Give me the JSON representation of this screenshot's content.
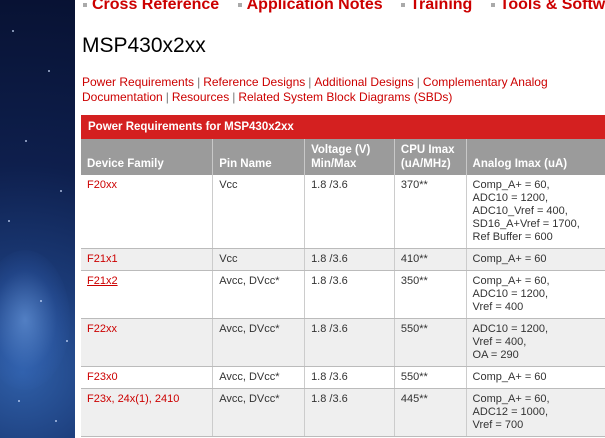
{
  "nav": {
    "items": [
      {
        "label": "Cross Reference"
      },
      {
        "label": "Application Notes"
      },
      {
        "label": "Training"
      },
      {
        "label": "Tools & Software"
      }
    ]
  },
  "page": {
    "title": "MSP430x2xx"
  },
  "quicklinks": [
    "Power Requirements",
    "Reference Designs",
    "Additional Designs",
    "Complementary Analog Documentation",
    "Resources",
    "Related System Block Diagrams (SBDs)"
  ],
  "table": {
    "caption": "Power Requirements for MSP430x2xx",
    "headers": {
      "device": "Device Family",
      "pin": "Pin Name",
      "voltage": "Voltage (V) Min/Max",
      "cpu": "CPU Imax (uA/MHz)",
      "analog": "Analog Imax (uA)"
    },
    "rows": [
      {
        "device": "F20xx",
        "pin": "Vcc",
        "voltage": "1.8 /3.6",
        "cpu": "370**",
        "analog": [
          "Comp_A+ = 60,",
          "ADC10 = 1200,",
          "ADC10_Vref = 400,",
          "SD16_A+Vref = 1700,",
          "Ref Buffer = 600"
        ]
      },
      {
        "device": "F21x1",
        "pin": "Vcc",
        "voltage": "1.8 /3.6",
        "cpu": "410**",
        "analog": [
          "Comp_A+ = 60"
        ]
      },
      {
        "device": "F21x2",
        "pin": "Avcc, DVcc*",
        "voltage": "1.8 /3.6",
        "cpu": "350**",
        "analog": [
          "Comp_A+ = 60,",
          "ADC10 = 1200,",
          "Vref = 400"
        ]
      },
      {
        "device": "F22xx",
        "pin": "Avcc, DVcc*",
        "voltage": "1.8 /3.6",
        "cpu": "550**",
        "analog": [
          "ADC10 = 1200,",
          "Vref = 400,",
          "OA = 290"
        ]
      },
      {
        "device": "F23x0",
        "pin": "Avcc, DVcc*",
        "voltage": "1.8 /3.6",
        "cpu": "550**",
        "analog": [
          "Comp_A+ = 60"
        ]
      },
      {
        "device": "F23x, 24x(1), 2410",
        "pin": "Avcc, DVcc*",
        "voltage": "1.8 /3.6",
        "cpu": "445**",
        "analog": [
          "Comp_A+ = 60,",
          "ADC12 = 1000,",
          "Vref = 700"
        ]
      }
    ]
  },
  "colors": {
    "accent": "#cc0000",
    "header_gray": "#9b9b9b",
    "caption_red": "#d42020"
  }
}
